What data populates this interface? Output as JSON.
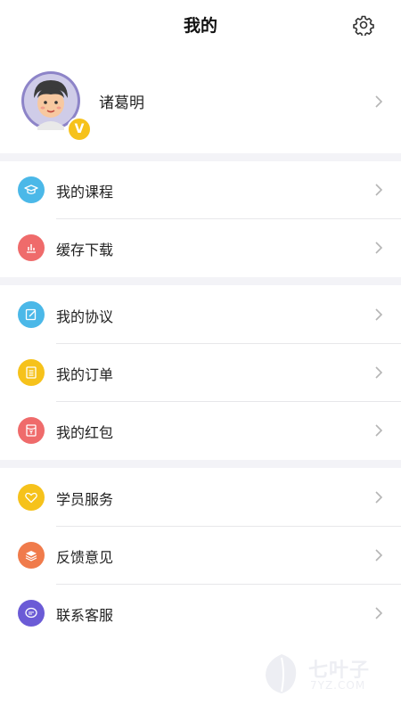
{
  "header": {
    "title": "我的"
  },
  "profile": {
    "name": "诸葛明",
    "badge": "V"
  },
  "groups": [
    {
      "items": [
        {
          "label": "我的课程",
          "icon": "graduation-cap-icon",
          "color": "#4bb8e8"
        },
        {
          "label": "缓存下载",
          "icon": "bar-chart-icon",
          "color": "#ef6b6b"
        }
      ]
    },
    {
      "items": [
        {
          "label": "我的协议",
          "icon": "edit-document-icon",
          "color": "#4bb8e8"
        },
        {
          "label": "我的订单",
          "icon": "order-list-icon",
          "color": "#f6c21b"
        },
        {
          "label": "我的红包",
          "icon": "red-envelope-icon",
          "color": "#ef6b6b"
        }
      ]
    },
    {
      "items": [
        {
          "label": "学员服务",
          "icon": "heart-icon",
          "color": "#f6c21b"
        },
        {
          "label": "反馈意见",
          "icon": "stack-icon",
          "color": "#f07b4b"
        },
        {
          "label": "联系客服",
          "icon": "chat-bubble-icon",
          "color": "#6b5bd6"
        }
      ]
    }
  ],
  "watermark": {
    "text": "七叶子",
    "domain": "7YZ.COM"
  }
}
